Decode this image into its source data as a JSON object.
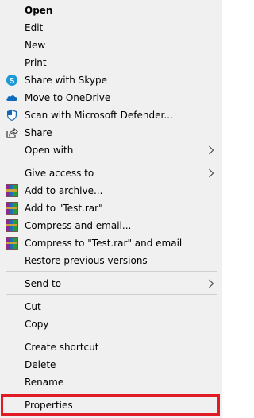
{
  "menu": {
    "open": "Open",
    "edit": "Edit",
    "new": "New",
    "print": "Print",
    "share_skype": "Share with Skype",
    "move_onedrive": "Move to OneDrive",
    "scan_defender": "Scan with Microsoft Defender...",
    "share": "Share",
    "open_with": "Open with",
    "give_access": "Give access to",
    "add_archive": "Add to archive...",
    "add_test_rar": "Add to \"Test.rar\"",
    "compress_email": "Compress and email...",
    "compress_test_email": "Compress to \"Test.rar\" and email",
    "restore_versions": "Restore previous versions",
    "send_to": "Send to",
    "cut": "Cut",
    "copy": "Copy",
    "create_shortcut": "Create shortcut",
    "delete": "Delete",
    "rename": "Rename",
    "properties": "Properties"
  },
  "colors": {
    "menu_bg": "#f0f0f0",
    "highlight_border": "#e11b24",
    "skype_blue": "#1c9ad6",
    "onedrive_blue": "#0f6cbd",
    "defender_blue": "#1466b8"
  },
  "icons": {
    "skype": "skype-icon",
    "onedrive": "onedrive-icon",
    "defender": "defender-shield-icon",
    "share": "share-icon",
    "winrar": "winrar-icon",
    "chevron": "chevron-right-icon"
  }
}
